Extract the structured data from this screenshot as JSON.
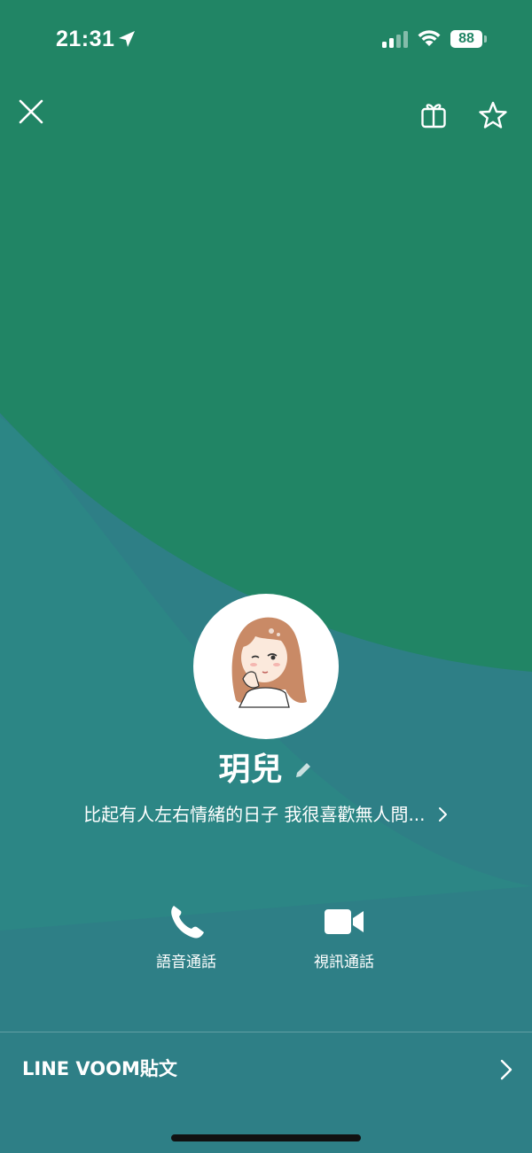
{
  "status_bar": {
    "time": "21:31",
    "location_icon": "location-arrow-icon",
    "signal_icon": "cellular-signal-icon",
    "wifi_icon": "wifi-icon",
    "battery_level": "88"
  },
  "header": {
    "close_icon": "close-icon",
    "gift_icon": "gift-icon",
    "favorite_icon": "star-icon"
  },
  "profile": {
    "name": "玥兒",
    "edit_icon": "pencil-icon",
    "status_message": "比起有人左右情緒的日子 我很喜歡無人問...",
    "status_chevron_icon": "chevron-right-icon"
  },
  "actions": {
    "voice_call_label": "語音通話",
    "video_call_label": "視訊通話",
    "voice_call_icon": "phone-icon",
    "video_call_icon": "video-camera-icon"
  },
  "voom": {
    "label": "LINE VOOM貼文",
    "chevron_icon": "chevron-right-icon"
  },
  "colors": {
    "top_background": "#218565",
    "lower_background": "#2e7f86",
    "wave": "#2c8a85",
    "text": "#ffffff"
  }
}
